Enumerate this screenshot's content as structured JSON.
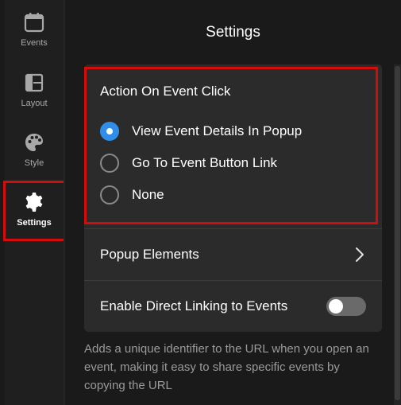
{
  "sidebar": {
    "items": [
      {
        "label": "Events",
        "icon": "calendar-icon",
        "active": false
      },
      {
        "label": "Layout",
        "icon": "layout-icon",
        "active": false
      },
      {
        "label": "Style",
        "icon": "palette-icon",
        "active": false
      },
      {
        "label": "Settings",
        "icon": "gear-icon",
        "active": true
      }
    ]
  },
  "main": {
    "title": "Settings",
    "action_section": {
      "title": "Action On Event Click",
      "options": [
        {
          "label": "View Event Details In Popup",
          "checked": true
        },
        {
          "label": "Go To Event Button Link",
          "checked": false
        },
        {
          "label": "None",
          "checked": false
        }
      ]
    },
    "popup_elements": {
      "label": "Popup Elements"
    },
    "direct_linking": {
      "label": "Enable Direct Linking to Events",
      "enabled": false
    },
    "help_text": "Adds a unique identifier to the URL when you open an event, making it easy to share specific events by copying the URL"
  },
  "colors": {
    "accent": "#2f8fe8",
    "highlight": "#d50c0c",
    "background": "#1a1a1a",
    "card": "#2b2b2b"
  }
}
